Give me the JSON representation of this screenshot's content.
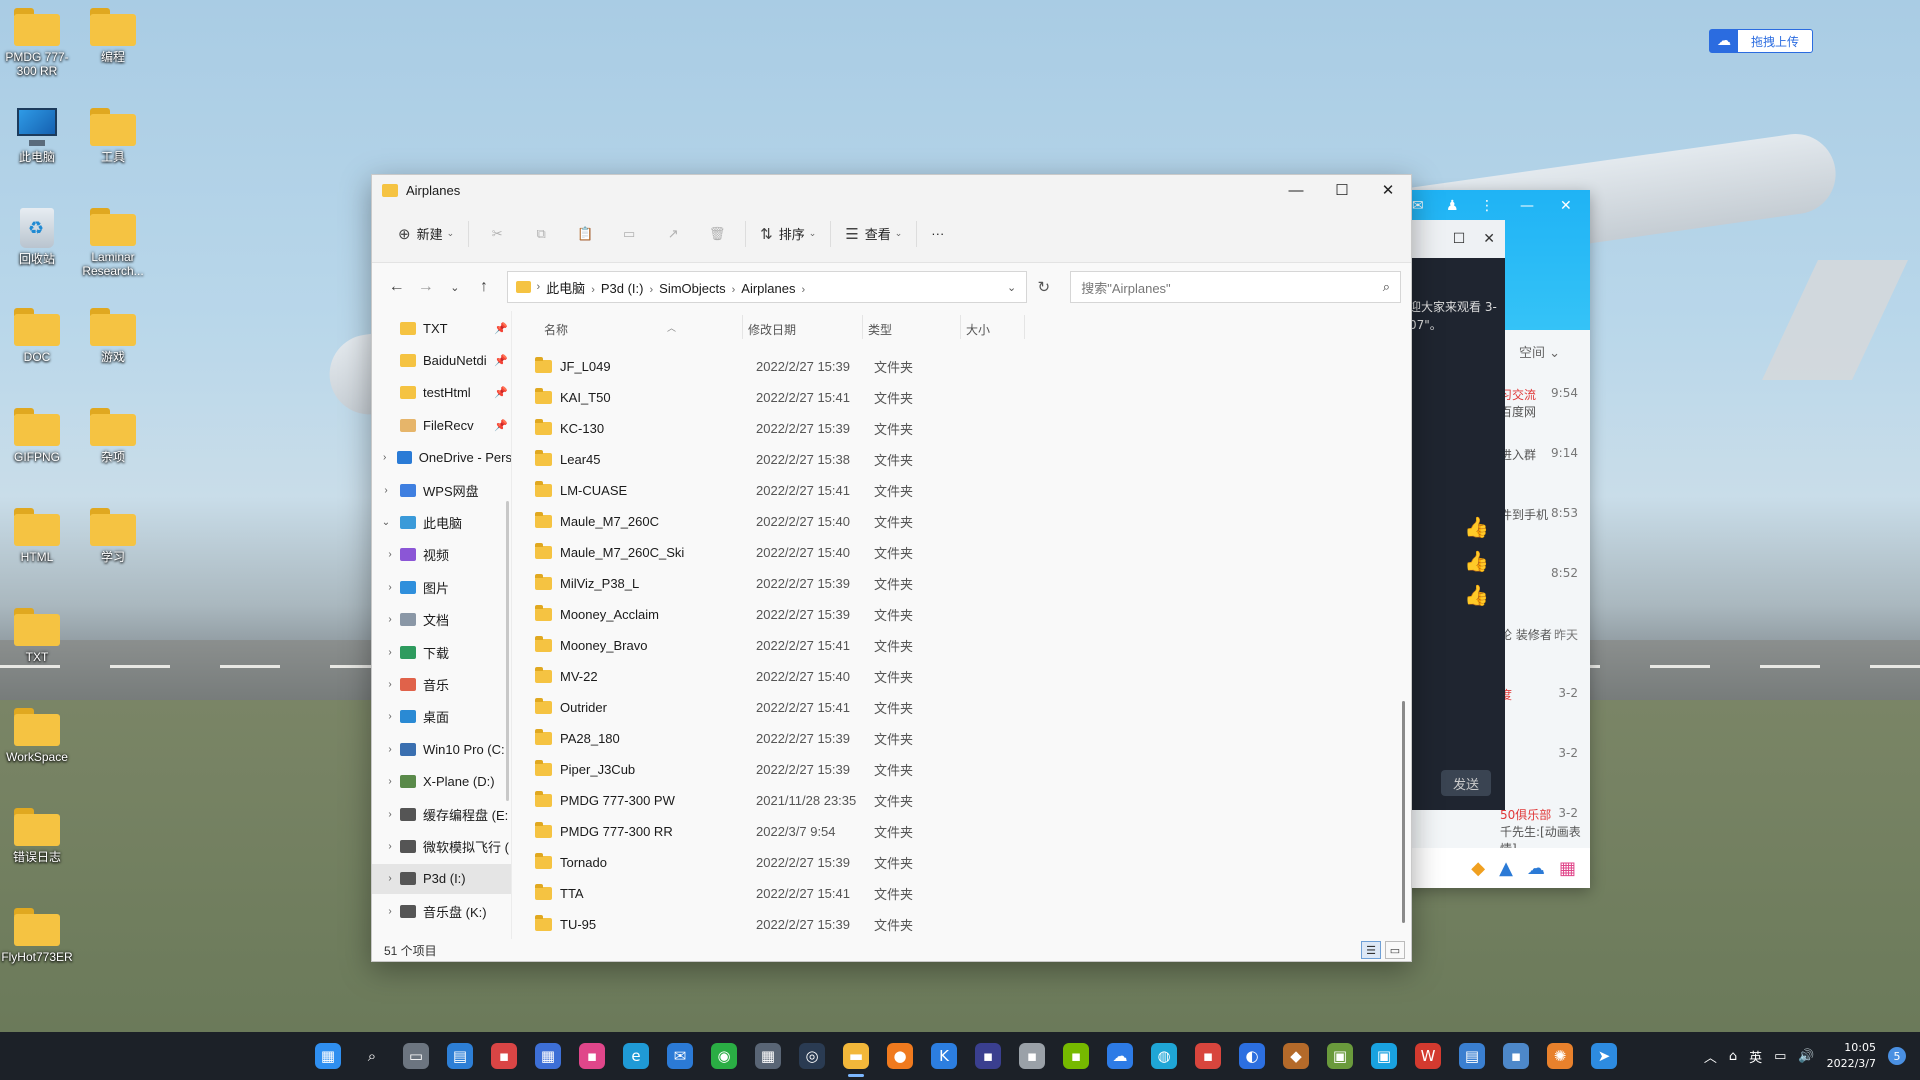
{
  "desktop": {
    "icons": [
      {
        "label": "PMDG 777-300 RR",
        "kind": "folder"
      },
      {
        "label": "编程",
        "kind": "folder"
      },
      {
        "label": "此电脑",
        "kind": "pc"
      },
      {
        "label": "工具",
        "kind": "folder"
      },
      {
        "label": "回收站",
        "kind": "bin"
      },
      {
        "label": "Laminar Research...",
        "kind": "folder"
      },
      {
        "label": "DOC",
        "kind": "folder"
      },
      {
        "label": "游戏",
        "kind": "folder"
      },
      {
        "label": "GIFPNG",
        "kind": "folder"
      },
      {
        "label": "杂项",
        "kind": "folder"
      },
      {
        "label": "HTML",
        "kind": "folder"
      },
      {
        "label": "学习",
        "kind": "folder"
      },
      {
        "label": "TXT",
        "kind": "folder"
      },
      {
        "label": "WorkSpace",
        "kind": "folder"
      },
      {
        "label": "错误日志",
        "kind": "folder"
      },
      {
        "label": "FlyHot773ER",
        "kind": "folder"
      }
    ],
    "upload_button": "拖拽上传"
  },
  "chat_window": {
    "space_label": "空间",
    "items": [
      {
        "title": "习交流",
        "sub": "百度网",
        "time": "9:54"
      },
      {
        "title": "",
        "sub": "进入群",
        "time": "9:14"
      },
      {
        "title": "",
        "sub": "件到手机",
        "time": "8:53"
      },
      {
        "title": "",
        "sub": "",
        "time": "8:52"
      },
      {
        "title": "",
        "sub": "论 装修者",
        "time": "昨天"
      },
      {
        "title": "度",
        "sub": "",
        "time": "3-2"
      },
      {
        "title": "",
        "sub": "",
        "time": "3-2"
      },
      {
        "title": "50俱乐部",
        "sub": "千先生:[动画表情]",
        "time": "3-2"
      }
    ]
  },
  "dark_window": {
    "message": "迎大家来观看 3-07\"。",
    "send": "发送"
  },
  "explorer": {
    "title": "Airplanes",
    "ribbon": {
      "new": "新建",
      "sort": "排序",
      "view": "查看",
      "more": "···"
    },
    "breadcrumbs": [
      "此电脑",
      "P3d (I:)",
      "SimObjects",
      "Airplanes"
    ],
    "search_placeholder": "搜索\"Airplanes\"",
    "columns": {
      "name": "名称",
      "modified": "修改日期",
      "type": "类型",
      "size": "大小"
    },
    "sidebar": [
      {
        "label": "TXT",
        "pinned": true,
        "color": "#f5c342",
        "indent": 1
      },
      {
        "label": "BaiduNetdi",
        "pinned": true,
        "color": "#f5c342",
        "indent": 1
      },
      {
        "label": "testHtml",
        "pinned": true,
        "color": "#f5c342",
        "indent": 1
      },
      {
        "label": "FileRecv",
        "pinned": true,
        "color": "#e6b56a",
        "indent": 1
      },
      {
        "label": "OneDrive - Pers",
        "pinned": false,
        "color": "#2a7bd6",
        "indent": 0,
        "expand": "›"
      },
      {
        "label": "WPS网盘",
        "pinned": false,
        "color": "#3f7fe0",
        "indent": 0,
        "expand": "›"
      },
      {
        "label": "此电脑",
        "pinned": false,
        "color": "#3a9ad9",
        "indent": 0,
        "expand": "⌄"
      },
      {
        "label": "视频",
        "pinned": false,
        "color": "#8b56d6",
        "indent": 1,
        "expand": "›"
      },
      {
        "label": "图片",
        "pinned": false,
        "color": "#2f8fdc",
        "indent": 1,
        "expand": "›"
      },
      {
        "label": "文档",
        "pinned": false,
        "color": "#8a97a6",
        "indent": 1,
        "expand": "›"
      },
      {
        "label": "下载",
        "pinned": false,
        "color": "#2e9b5e",
        "indent": 1,
        "expand": "›"
      },
      {
        "label": "音乐",
        "pinned": false,
        "color": "#e0624a",
        "indent": 1,
        "expand": "›"
      },
      {
        "label": "桌面",
        "pinned": false,
        "color": "#2a8ad4",
        "indent": 1,
        "expand": "›"
      },
      {
        "label": "Win10 Pro (C:",
        "pinned": false,
        "color": "#3a6fb0",
        "indent": 1,
        "expand": "›"
      },
      {
        "label": "X-Plane (D:)",
        "pinned": false,
        "color": "#5a8a4a",
        "indent": 1,
        "expand": "›"
      },
      {
        "label": "缓存编程盘 (E:",
        "pinned": false,
        "color": "#555",
        "indent": 1,
        "expand": "›"
      },
      {
        "label": "微软模拟飞行 (",
        "pinned": false,
        "color": "#555",
        "indent": 1,
        "expand": "›"
      },
      {
        "label": "P3d (I:)",
        "pinned": false,
        "color": "#555",
        "indent": 1,
        "expand": "›",
        "selected": true
      },
      {
        "label": "音乐盘 (K:)",
        "pinned": false,
        "color": "#555",
        "indent": 1,
        "expand": "›"
      }
    ],
    "files": [
      {
        "name": "JF_L049",
        "date": "2022/2/27 15:39",
        "type": "文件夹"
      },
      {
        "name": "KAI_T50",
        "date": "2022/2/27 15:41",
        "type": "文件夹"
      },
      {
        "name": "KC-130",
        "date": "2022/2/27 15:39",
        "type": "文件夹"
      },
      {
        "name": "Lear45",
        "date": "2022/2/27 15:38",
        "type": "文件夹"
      },
      {
        "name": "LM-CUASE",
        "date": "2022/2/27 15:41",
        "type": "文件夹"
      },
      {
        "name": "Maule_M7_260C",
        "date": "2022/2/27 15:40",
        "type": "文件夹"
      },
      {
        "name": "Maule_M7_260C_Ski",
        "date": "2022/2/27 15:40",
        "type": "文件夹"
      },
      {
        "name": "MilViz_P38_L",
        "date": "2022/2/27 15:39",
        "type": "文件夹"
      },
      {
        "name": "Mooney_Acclaim",
        "date": "2022/2/27 15:39",
        "type": "文件夹"
      },
      {
        "name": "Mooney_Bravo",
        "date": "2022/2/27 15:41",
        "type": "文件夹"
      },
      {
        "name": "MV-22",
        "date": "2022/2/27 15:40",
        "type": "文件夹"
      },
      {
        "name": "Outrider",
        "date": "2022/2/27 15:41",
        "type": "文件夹"
      },
      {
        "name": "PA28_180",
        "date": "2022/2/27 15:39",
        "type": "文件夹"
      },
      {
        "name": "Piper_J3Cub",
        "date": "2022/2/27 15:39",
        "type": "文件夹"
      },
      {
        "name": "PMDG 777-300 PW",
        "date": "2021/11/28 23:35",
        "type": "文件夹"
      },
      {
        "name": "PMDG 777-300 RR",
        "date": "2022/3/7 9:54",
        "type": "文件夹"
      },
      {
        "name": "Tornado",
        "date": "2022/2/27 15:39",
        "type": "文件夹"
      },
      {
        "name": "TTA",
        "date": "2022/2/27 15:41",
        "type": "文件夹"
      },
      {
        "name": "TU-95",
        "date": "2022/2/27 15:39",
        "type": "文件夹"
      }
    ],
    "status": "51 个项目"
  },
  "taskbar": {
    "apps": [
      {
        "name": "start-icon",
        "glyph": "▦",
        "color": "#2f8ff0"
      },
      {
        "name": "search-icon",
        "glyph": "⌕",
        "color": "transparent"
      },
      {
        "name": "task-view-icon",
        "glyph": "▭",
        "color": "#6c7580"
      },
      {
        "name": "widgets-icon",
        "glyph": "▤",
        "color": "#2d7fd6"
      },
      {
        "name": "app-icon",
        "glyph": "▪",
        "color": "#d94545"
      },
      {
        "name": "store-icon",
        "glyph": "▦",
        "color": "#3d6fd6"
      },
      {
        "name": "app-icon",
        "glyph": "▪",
        "color": "#e0468a"
      },
      {
        "name": "edge-icon",
        "glyph": "e",
        "color": "#1f9ad6"
      },
      {
        "name": "mail-icon",
        "glyph": "✉",
        "color": "#2b7ad6"
      },
      {
        "name": "wechat-icon",
        "glyph": "◉",
        "color": "#2aae44"
      },
      {
        "name": "calculator-icon",
        "glyph": "▦",
        "color": "#596575"
      },
      {
        "name": "steam-icon",
        "glyph": "◎",
        "color": "#2a3b52"
      },
      {
        "name": "file-explorer-icon",
        "glyph": "▬",
        "color": "#f2b73a",
        "active": true
      },
      {
        "name": "firefox-icon",
        "glyph": "●",
        "color": "#f07a1e"
      },
      {
        "name": "app-icon",
        "glyph": "K",
        "color": "#2c7ee0"
      },
      {
        "name": "app-icon",
        "glyph": "▪",
        "color": "#3a3f8f"
      },
      {
        "name": "app-icon",
        "glyph": "▪",
        "color": "#9aa1a8"
      },
      {
        "name": "nvidia-icon",
        "glyph": "▪",
        "color": "#76b900"
      },
      {
        "name": "baidu-netdisk-icon",
        "glyph": "☁",
        "color": "#2d7be6"
      },
      {
        "name": "app-icon",
        "glyph": "◍",
        "color": "#1fa6d6"
      },
      {
        "name": "app-icon",
        "glyph": "▪",
        "color": "#d8453d"
      },
      {
        "name": "app-icon",
        "glyph": "◐",
        "color": "#2c6fe0"
      },
      {
        "name": "app-icon",
        "glyph": "◆",
        "color": "#b46a2a"
      },
      {
        "name": "minecraft-icon",
        "glyph": "▣",
        "color": "#6a9a3c"
      },
      {
        "name": "bilibili-icon",
        "glyph": "▣",
        "color": "#19a2e0"
      },
      {
        "name": "wps-icon",
        "glyph": "W",
        "color": "#d33a2f"
      },
      {
        "name": "notepad-icon",
        "glyph": "▤",
        "color": "#3a7fd0"
      },
      {
        "name": "app-icon",
        "glyph": "▪",
        "color": "#4d88c9"
      },
      {
        "name": "settings-icon",
        "glyph": "✺",
        "color": "#e8812c"
      },
      {
        "name": "app-icon",
        "glyph": "➤",
        "color": "#2d8be0"
      }
    ],
    "ime": "英",
    "time": "10:05",
    "date": "2022/3/7",
    "notifications": "5"
  }
}
